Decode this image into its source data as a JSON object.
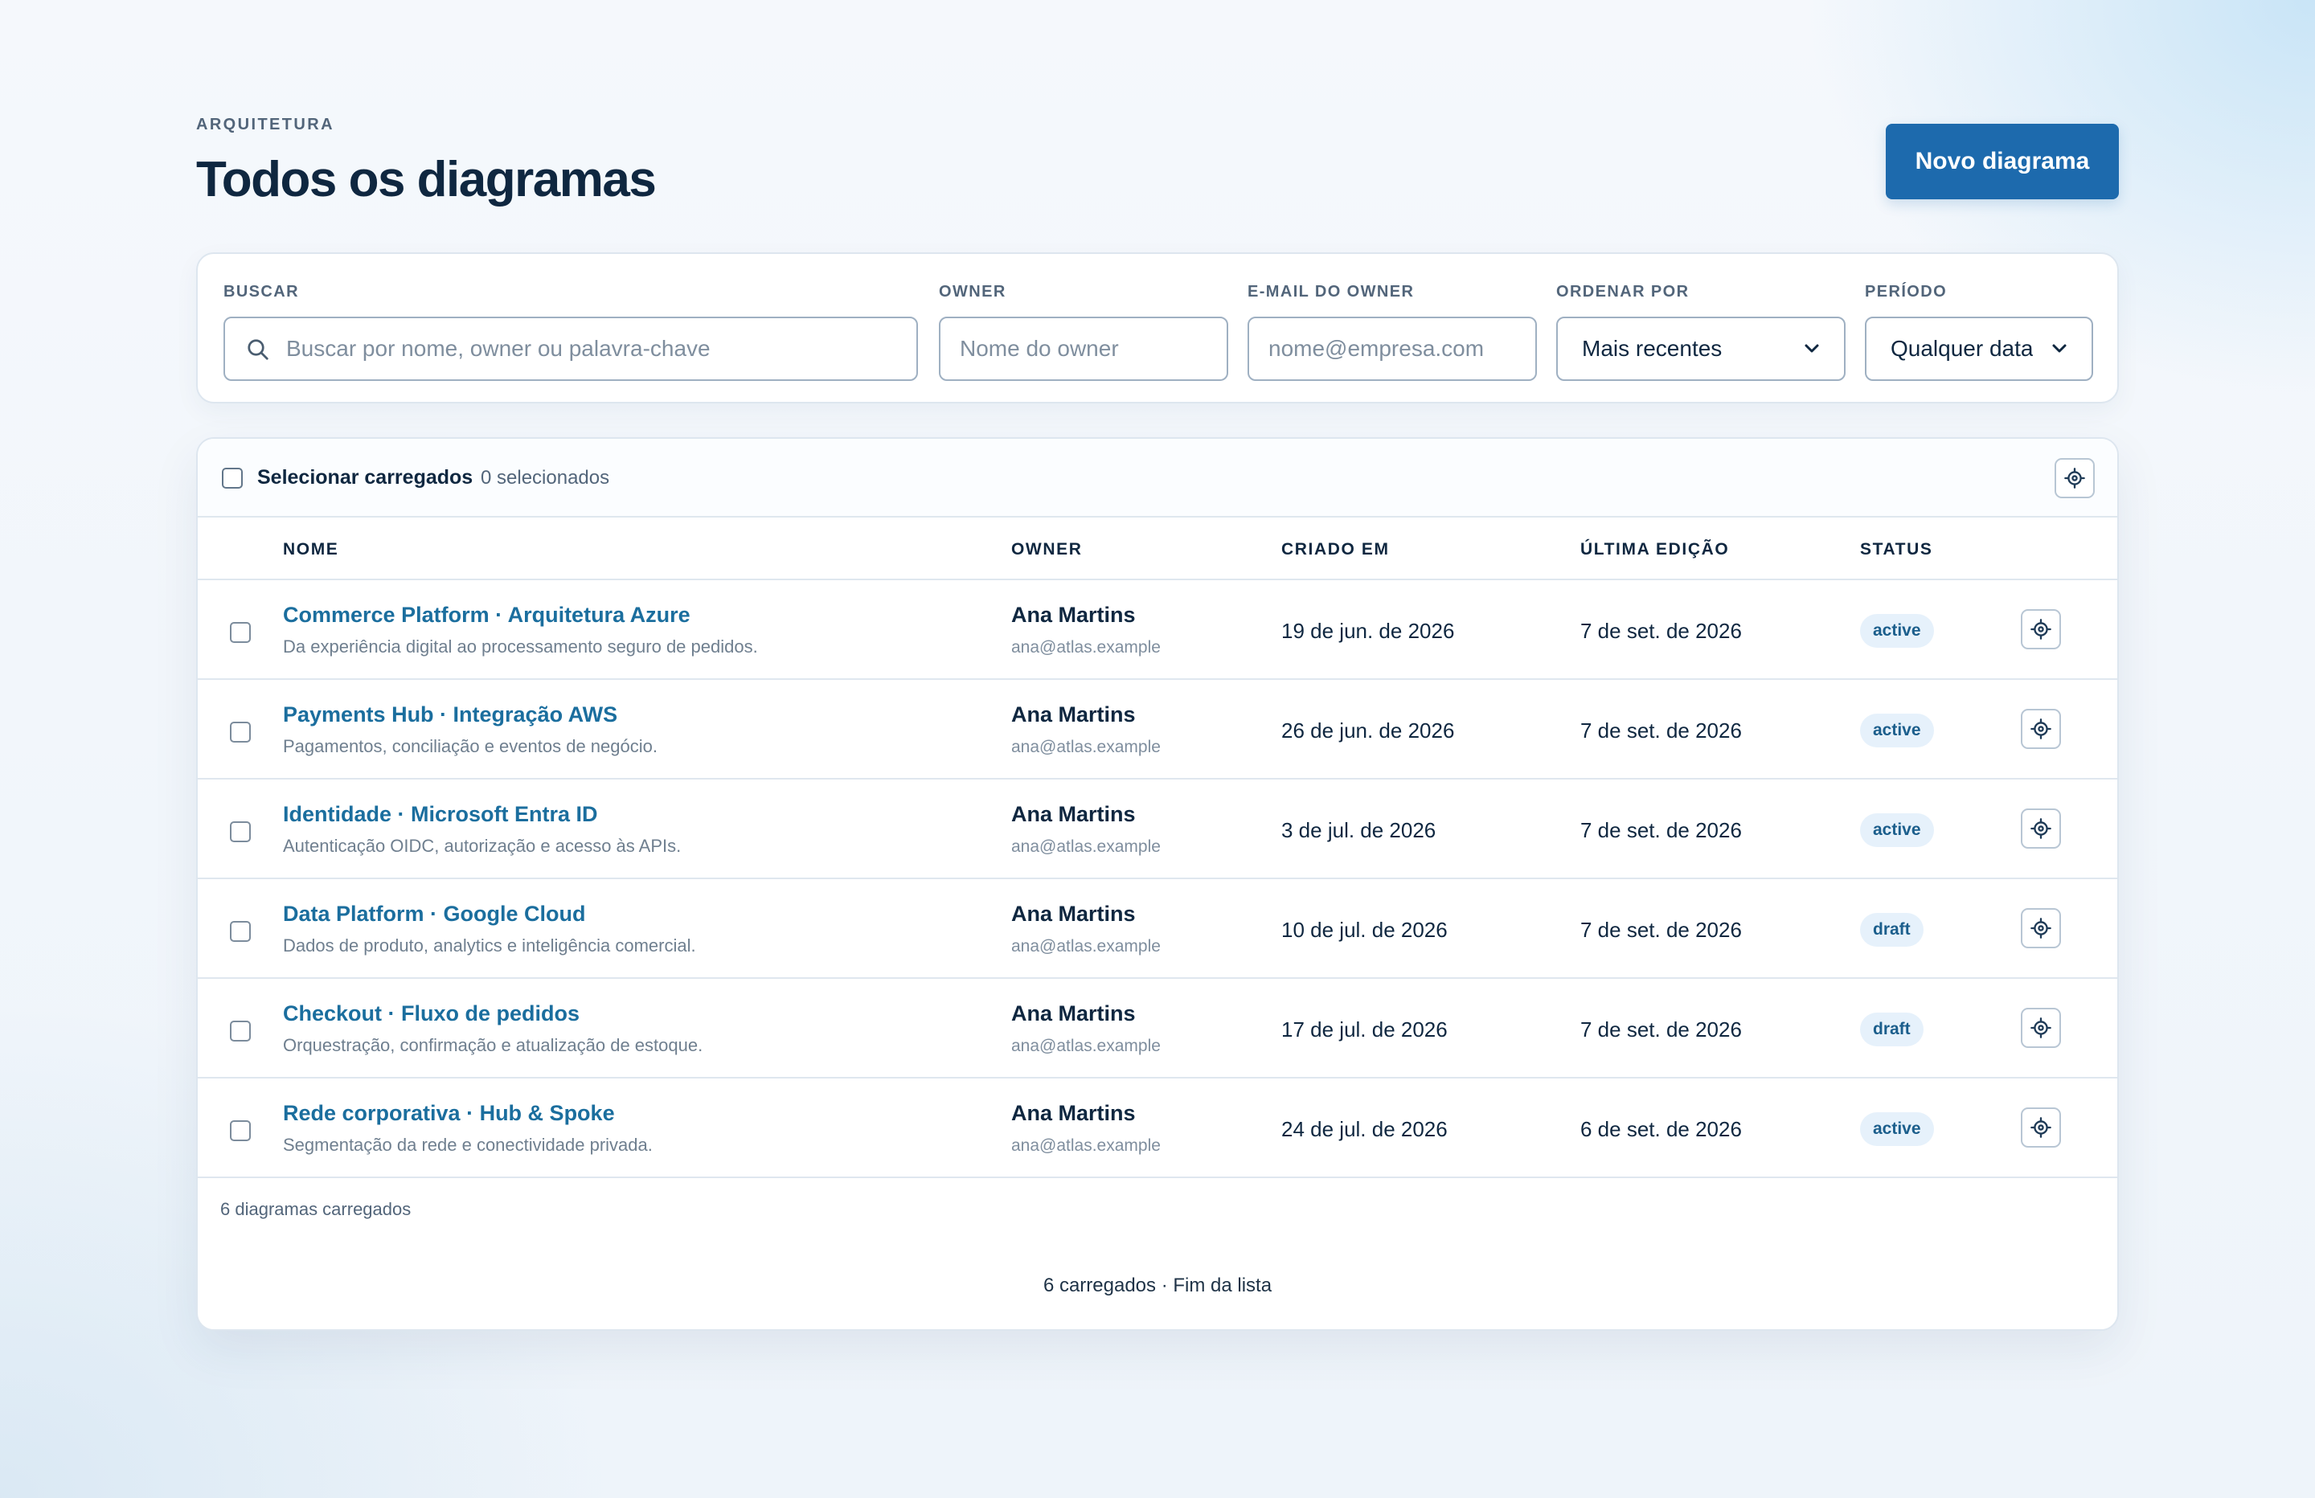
{
  "header": {
    "eyebrow": "ARQUITETURA",
    "title": "Todos os diagramas",
    "new_button": "Novo diagrama"
  },
  "filters": {
    "search": {
      "label": "BUSCAR",
      "placeholder": "Buscar por nome, owner ou palavra-chave",
      "value": ""
    },
    "owner": {
      "label": "OWNER",
      "placeholder": "Nome do owner",
      "value": ""
    },
    "owner_email": {
      "label": "E-MAIL DO OWNER",
      "placeholder": "nome@empresa.com",
      "value": ""
    },
    "sort": {
      "label": "ORDENAR POR",
      "selected": "Mais recentes"
    },
    "period": {
      "label": "PERÍODO",
      "selected": "Qualquer data"
    }
  },
  "toolbar": {
    "select_loaded": "Selecionar carregados",
    "selected_count": "0 selecionados"
  },
  "table": {
    "columns": [
      "NOME",
      "OWNER",
      "CRIADO EM",
      "ÚLTIMA EDIÇÃO",
      "STATUS"
    ],
    "rows": [
      {
        "name": "Commerce Platform · Arquitetura Azure",
        "description": "Da experiência digital ao processamento seguro de pedidos.",
        "owner": "Ana Martins",
        "email": "ana@atlas.example",
        "created": "19 de jun. de 2026",
        "edited": "7 de set. de 2026",
        "status": "active"
      },
      {
        "name": "Payments Hub · Integração AWS",
        "description": "Pagamentos, conciliação e eventos de negócio.",
        "owner": "Ana Martins",
        "email": "ana@atlas.example",
        "created": "26 de jun. de 2026",
        "edited": "7 de set. de 2026",
        "status": "active"
      },
      {
        "name": "Identidade · Microsoft Entra ID",
        "description": "Autenticação OIDC, autorização e acesso às APIs.",
        "owner": "Ana Martins",
        "email": "ana@atlas.example",
        "created": "3 de jul. de 2026",
        "edited": "7 de set. de 2026",
        "status": "active"
      },
      {
        "name": "Data Platform · Google Cloud",
        "description": "Dados de produto, analytics e inteligência comercial.",
        "owner": "Ana Martins",
        "email": "ana@atlas.example",
        "created": "10 de jul. de 2026",
        "edited": "7 de set. de 2026",
        "status": "draft"
      },
      {
        "name": "Checkout · Fluxo de pedidos",
        "description": "Orquestração, confirmação e atualização de estoque.",
        "owner": "Ana Martins",
        "email": "ana@atlas.example",
        "created": "17 de jul. de 2026",
        "edited": "7 de set. de 2026",
        "status": "draft"
      },
      {
        "name": "Rede corporativa · Hub & Spoke",
        "description": "Segmentação da rede e conectividade privada.",
        "owner": "Ana Martins",
        "email": "ana@atlas.example",
        "created": "24 de jul. de 2026",
        "edited": "6 de set. de 2026",
        "status": "active"
      }
    ]
  },
  "footer": {
    "loaded_count": "6 diagramas carregados",
    "end_of_list": "6 carregados · Fim da lista"
  },
  "icons": {
    "search": "search-icon",
    "chevron": "chevron-down-icon",
    "settings": "gear-icon"
  },
  "colors": {
    "primary": "#1d6aad",
    "link": "#1b6e9e",
    "badge_bg": "#e6f1fb",
    "text": "#0f2740"
  }
}
